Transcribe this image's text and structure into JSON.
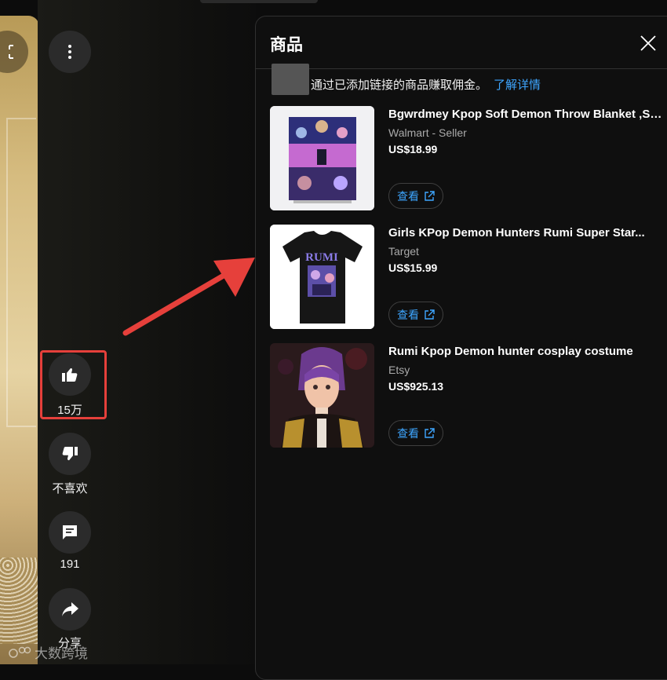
{
  "actions": {
    "like_count": "15万",
    "dislike_label": "不喜欢",
    "comment_count": "191",
    "share_label": "分享"
  },
  "panel": {
    "title": "商品",
    "notice": "通过已添加链接的商品赚取佣金。",
    "learn_more": "了解详情"
  },
  "products": [
    {
      "title": "Bgwrdmey Kpop Soft Demon Throw Blanket ,So...",
      "seller": "Walmart - Seller",
      "price": "US$18.99",
      "button": "查看"
    },
    {
      "title": "Girls KPop Demon Hunters Rumi Super Star...",
      "seller": "Target",
      "price": "US$15.99",
      "button": "查看",
      "shirt_text": "RUMI"
    },
    {
      "title": "Rumi Kpop Demon hunter cosplay costume",
      "seller": "Etsy",
      "price": "US$925.13",
      "button": "查看"
    }
  ],
  "watermark": "大数跨境",
  "colors": {
    "accent_link": "#3ea6ff",
    "highlight": "#e6403b",
    "panel_bg": "#0f0f0f"
  },
  "icons": [
    "fullscreen-icon",
    "more-vert-icon",
    "thumb-up-icon",
    "thumb-down-icon",
    "comment-icon",
    "share-icon",
    "close-icon",
    "external-link-icon"
  ]
}
